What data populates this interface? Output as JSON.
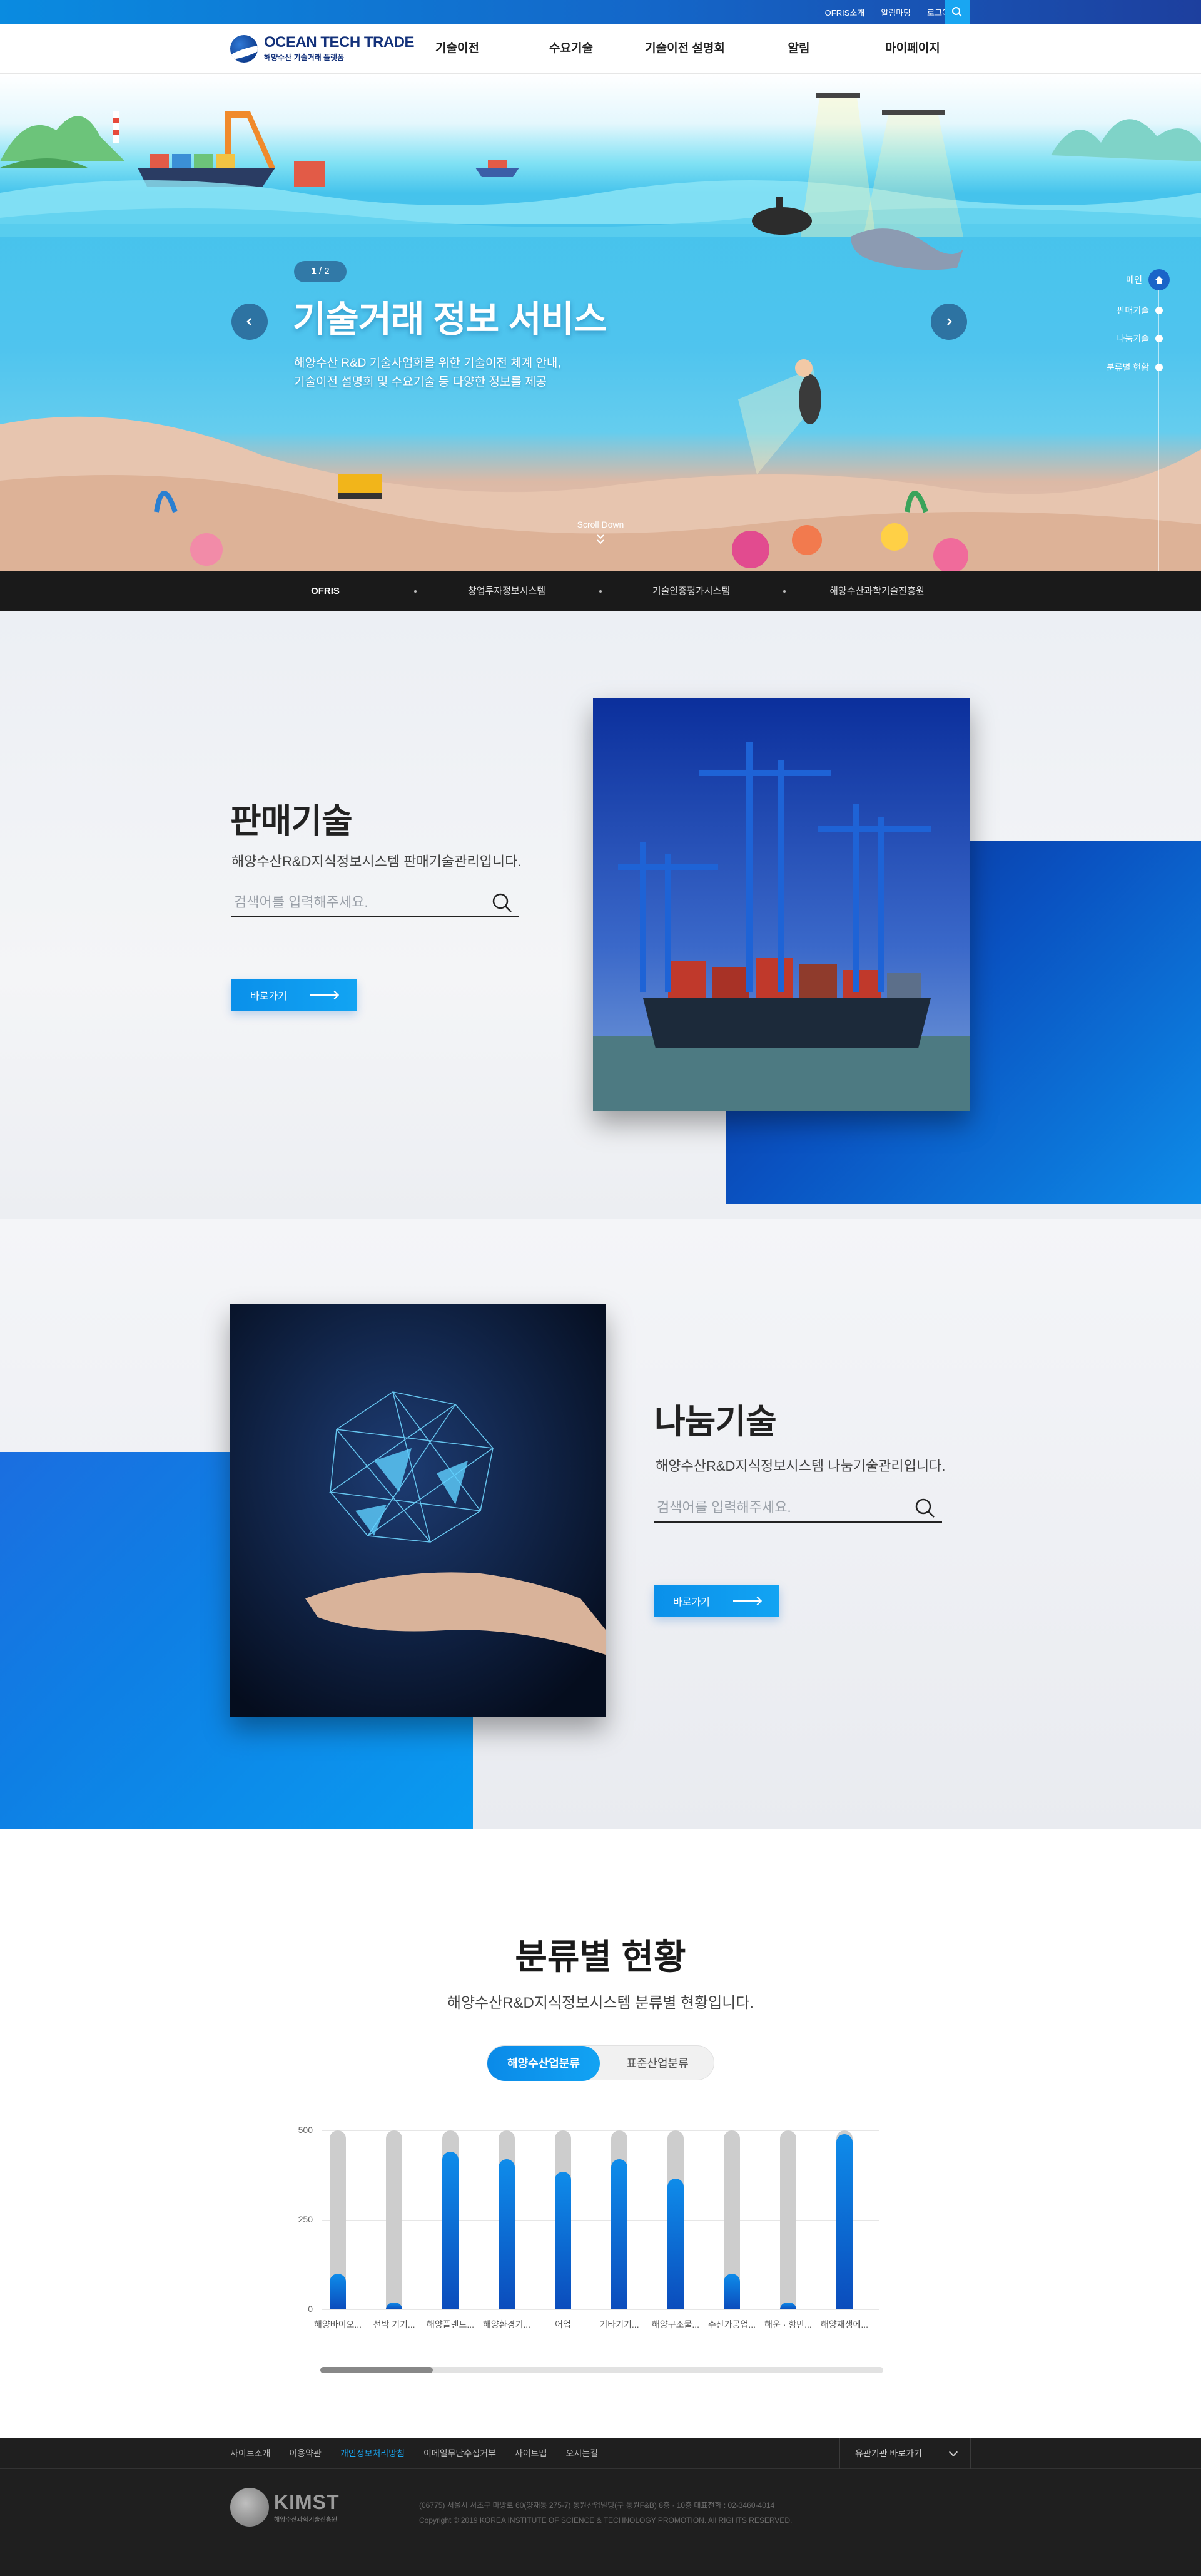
{
  "topbar": {
    "links": [
      "OFRIS소개",
      "알림마당",
      "로그아웃"
    ],
    "colors": {
      "primary": "#1466c8",
      "accent": "#19a6f2"
    }
  },
  "header": {
    "logo_title": "OCEAN TECH TRADE",
    "logo_sub": "해양수산 기술거래 플랫폼",
    "nav": [
      "기술이전",
      "수요기술",
      "기술이전 설명회",
      "알림",
      "마이페이지"
    ]
  },
  "hero": {
    "pager_current": "1",
    "pager_total": "2",
    "title": "기술거래 정보 서비스",
    "desc_line1": "해양수산 R&D 기술사업화를 위한 기술이전 체계 안내,",
    "desc_line2": "기술이전 설명회 및 수요기술 등 다양한 정보를 제공",
    "scroll_label": "Scroll Down",
    "side_nav": [
      "메인",
      "판매기술",
      "나눔기술",
      "분류별 현황"
    ]
  },
  "linkbar": [
    "OFRIS",
    "창업투자정보시스템",
    "기술인증평가시스템",
    "해양수산과학기술진흥원"
  ],
  "sales": {
    "title": "판매기술",
    "desc": "해양수산R&D지식정보시스템 판매기술관리입니다.",
    "placeholder": "검색어를 입력해주세요.",
    "button": "바로가기"
  },
  "sharing": {
    "title": "나눔기술",
    "desc": "해양수산R&D지식정보시스템 나눔기술관리입니다.",
    "placeholder": "검색어를 입력해주세요.",
    "button": "바로가기"
  },
  "stats": {
    "title": "분류별 현황",
    "desc": "해양수산R&D지식정보시스템 분류별 현황입니다.",
    "tabs": [
      "해양수산업분류",
      "표준산업분류"
    ],
    "active_tab": "해양수산업분류"
  },
  "chart_data": {
    "type": "bar",
    "categories": [
      "해양바이오...",
      "선박 기기...",
      "해양플랜트...",
      "해양환경기...",
      "어업",
      "기타기기...",
      "해양구조물...",
      "수산가공업...",
      "해운 · 항만...",
      "해양재생에..."
    ],
    "values": [
      100,
      20,
      440,
      420,
      385,
      420,
      365,
      100,
      20,
      490
    ],
    "yticks": [
      "500",
      "250",
      "0"
    ],
    "ylim": [
      0,
      500
    ],
    "grid": true
  },
  "footer": {
    "links": [
      "사이트소개",
      "이용약관",
      "개인정보처리방침",
      "이메일무단수집거부",
      "사이트맵",
      "오시는길"
    ],
    "highlight_link": "개인정보처리방침",
    "family_site": "유관기관 바로가기",
    "logo_text": "KIMST",
    "logo_sub": "해양수산과학기술진흥원",
    "address": "(06775) 서울시 서초구 마방로 60(양재동 275-7) 동원산업빌딩(구 동원F&B) 8층 · 10층  대표전화 : 02-3460-4014",
    "copyright": "Copyright © 2019 KOREA INSTITUTE OF SCIENCE & TECHNOLOGY PROMOTION. All RIGHTS RESERVED."
  }
}
